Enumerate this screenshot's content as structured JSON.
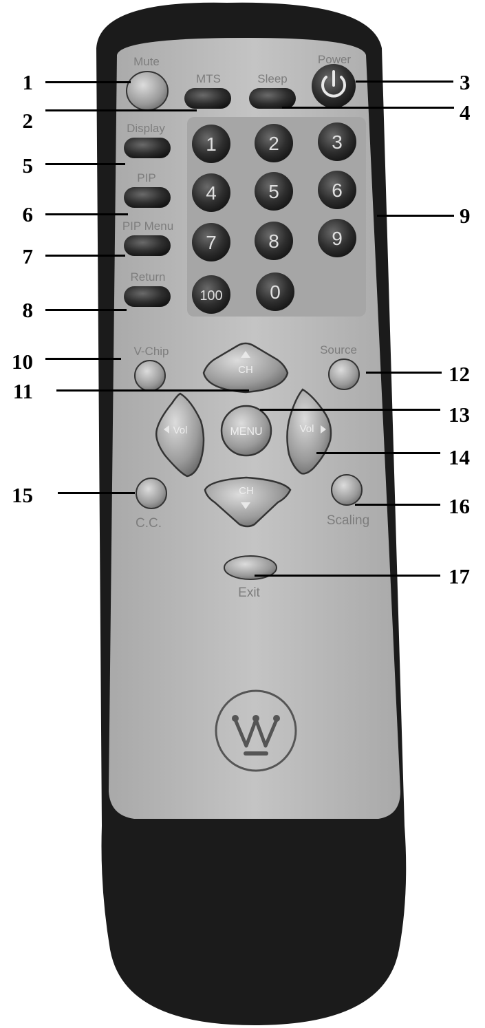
{
  "remote": {
    "labels": {
      "mute": "Mute",
      "mts": "MTS",
      "sleep": "Sleep",
      "power": "Power",
      "display": "Display",
      "pip": "PIP",
      "pip_menu": "PIP Menu",
      "return": "Return",
      "vchip": "V-Chip",
      "source": "Source",
      "cc": "C.C.",
      "scaling": "Scaling",
      "exit": "Exit"
    },
    "keys": {
      "k1": "1",
      "k2": "2",
      "k3": "3",
      "k4": "4",
      "k5": "5",
      "k6": "6",
      "k7": "7",
      "k8": "8",
      "k9": "9",
      "k100": "100",
      "k0": "0"
    },
    "nav": {
      "ch_up": "CH",
      "ch_down": "CH",
      "vol_left": "Vol",
      "vol_right": "Vol",
      "menu": "MENU"
    },
    "power_symbol": "⏻"
  },
  "callouts": [
    {
      "n": "1"
    },
    {
      "n": "2"
    },
    {
      "n": "3"
    },
    {
      "n": "4"
    },
    {
      "n": "5"
    },
    {
      "n": "6"
    },
    {
      "n": "7"
    },
    {
      "n": "8"
    },
    {
      "n": "9"
    },
    {
      "n": "10"
    },
    {
      "n": "11"
    },
    {
      "n": "12"
    },
    {
      "n": "13"
    },
    {
      "n": "14"
    },
    {
      "n": "15"
    },
    {
      "n": "16"
    },
    {
      "n": "17"
    }
  ],
  "colors": {
    "body_black": "#1b1b1b",
    "panel_gray": "#b9b9b9",
    "key_dark": "#2a2a2a",
    "label_gray": "#7d7d7d"
  }
}
